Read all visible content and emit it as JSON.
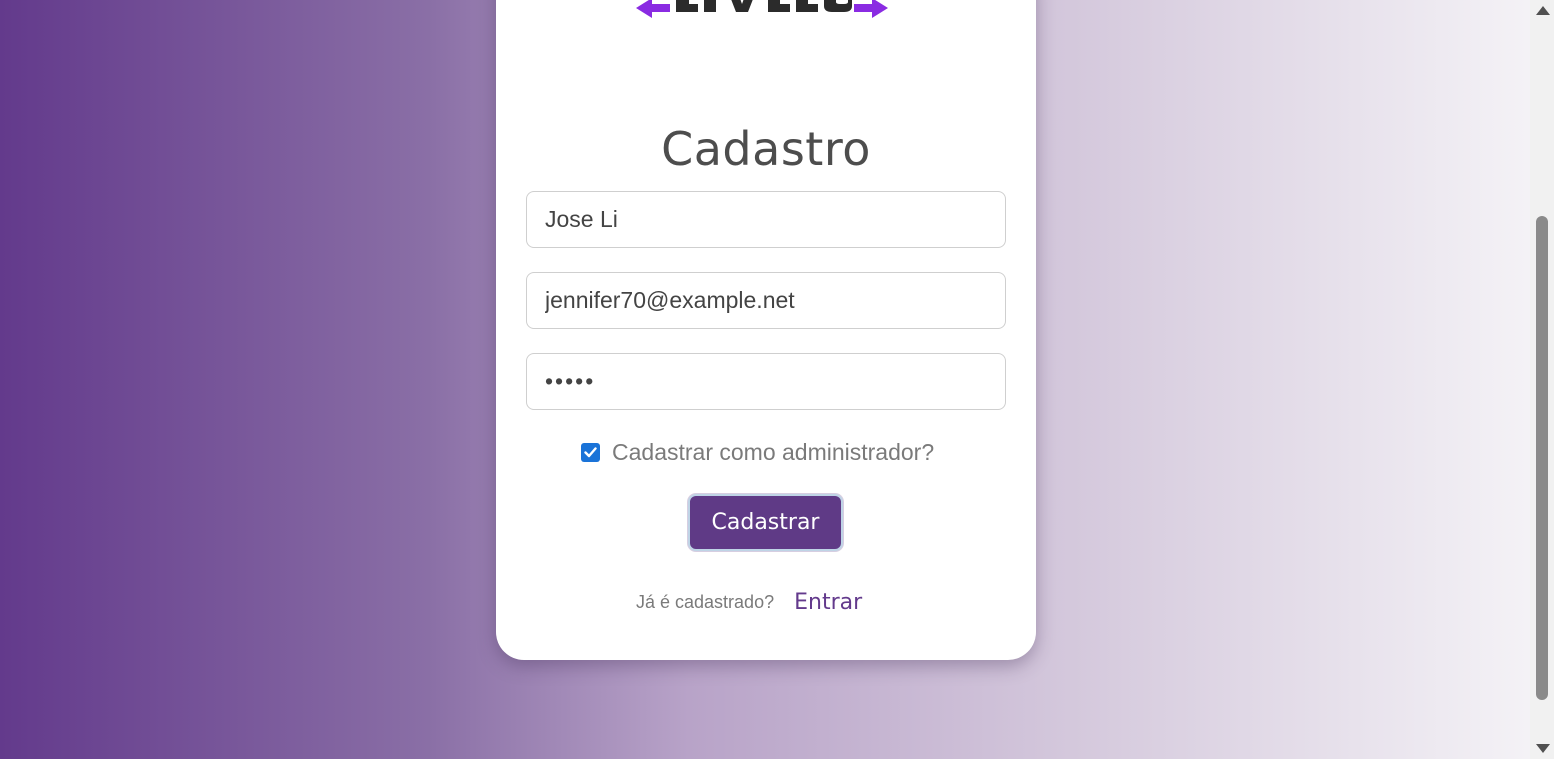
{
  "form": {
    "title": "Cadastro",
    "name_value": "Jose Li",
    "email_value": "jennifer70@example.net",
    "password_value": "•••••",
    "admin_checkbox_label": "Cadastrar como administrador?",
    "admin_checked": true,
    "submit_label": "Cadastrar"
  },
  "login": {
    "question": "Já é cadastrado?",
    "link_label": "Entrar"
  },
  "colors": {
    "brand_purple": "#633a8c",
    "button_purple": "#5f3a86",
    "checkbox_blue": "#1a73d8",
    "logo_arrow": "#8a2be2"
  },
  "icons": {
    "logo": "brand-logo",
    "checkbox": "check-icon",
    "scroll_up": "scroll-up-arrow-icon",
    "scroll_down": "scroll-down-arrow-icon"
  }
}
